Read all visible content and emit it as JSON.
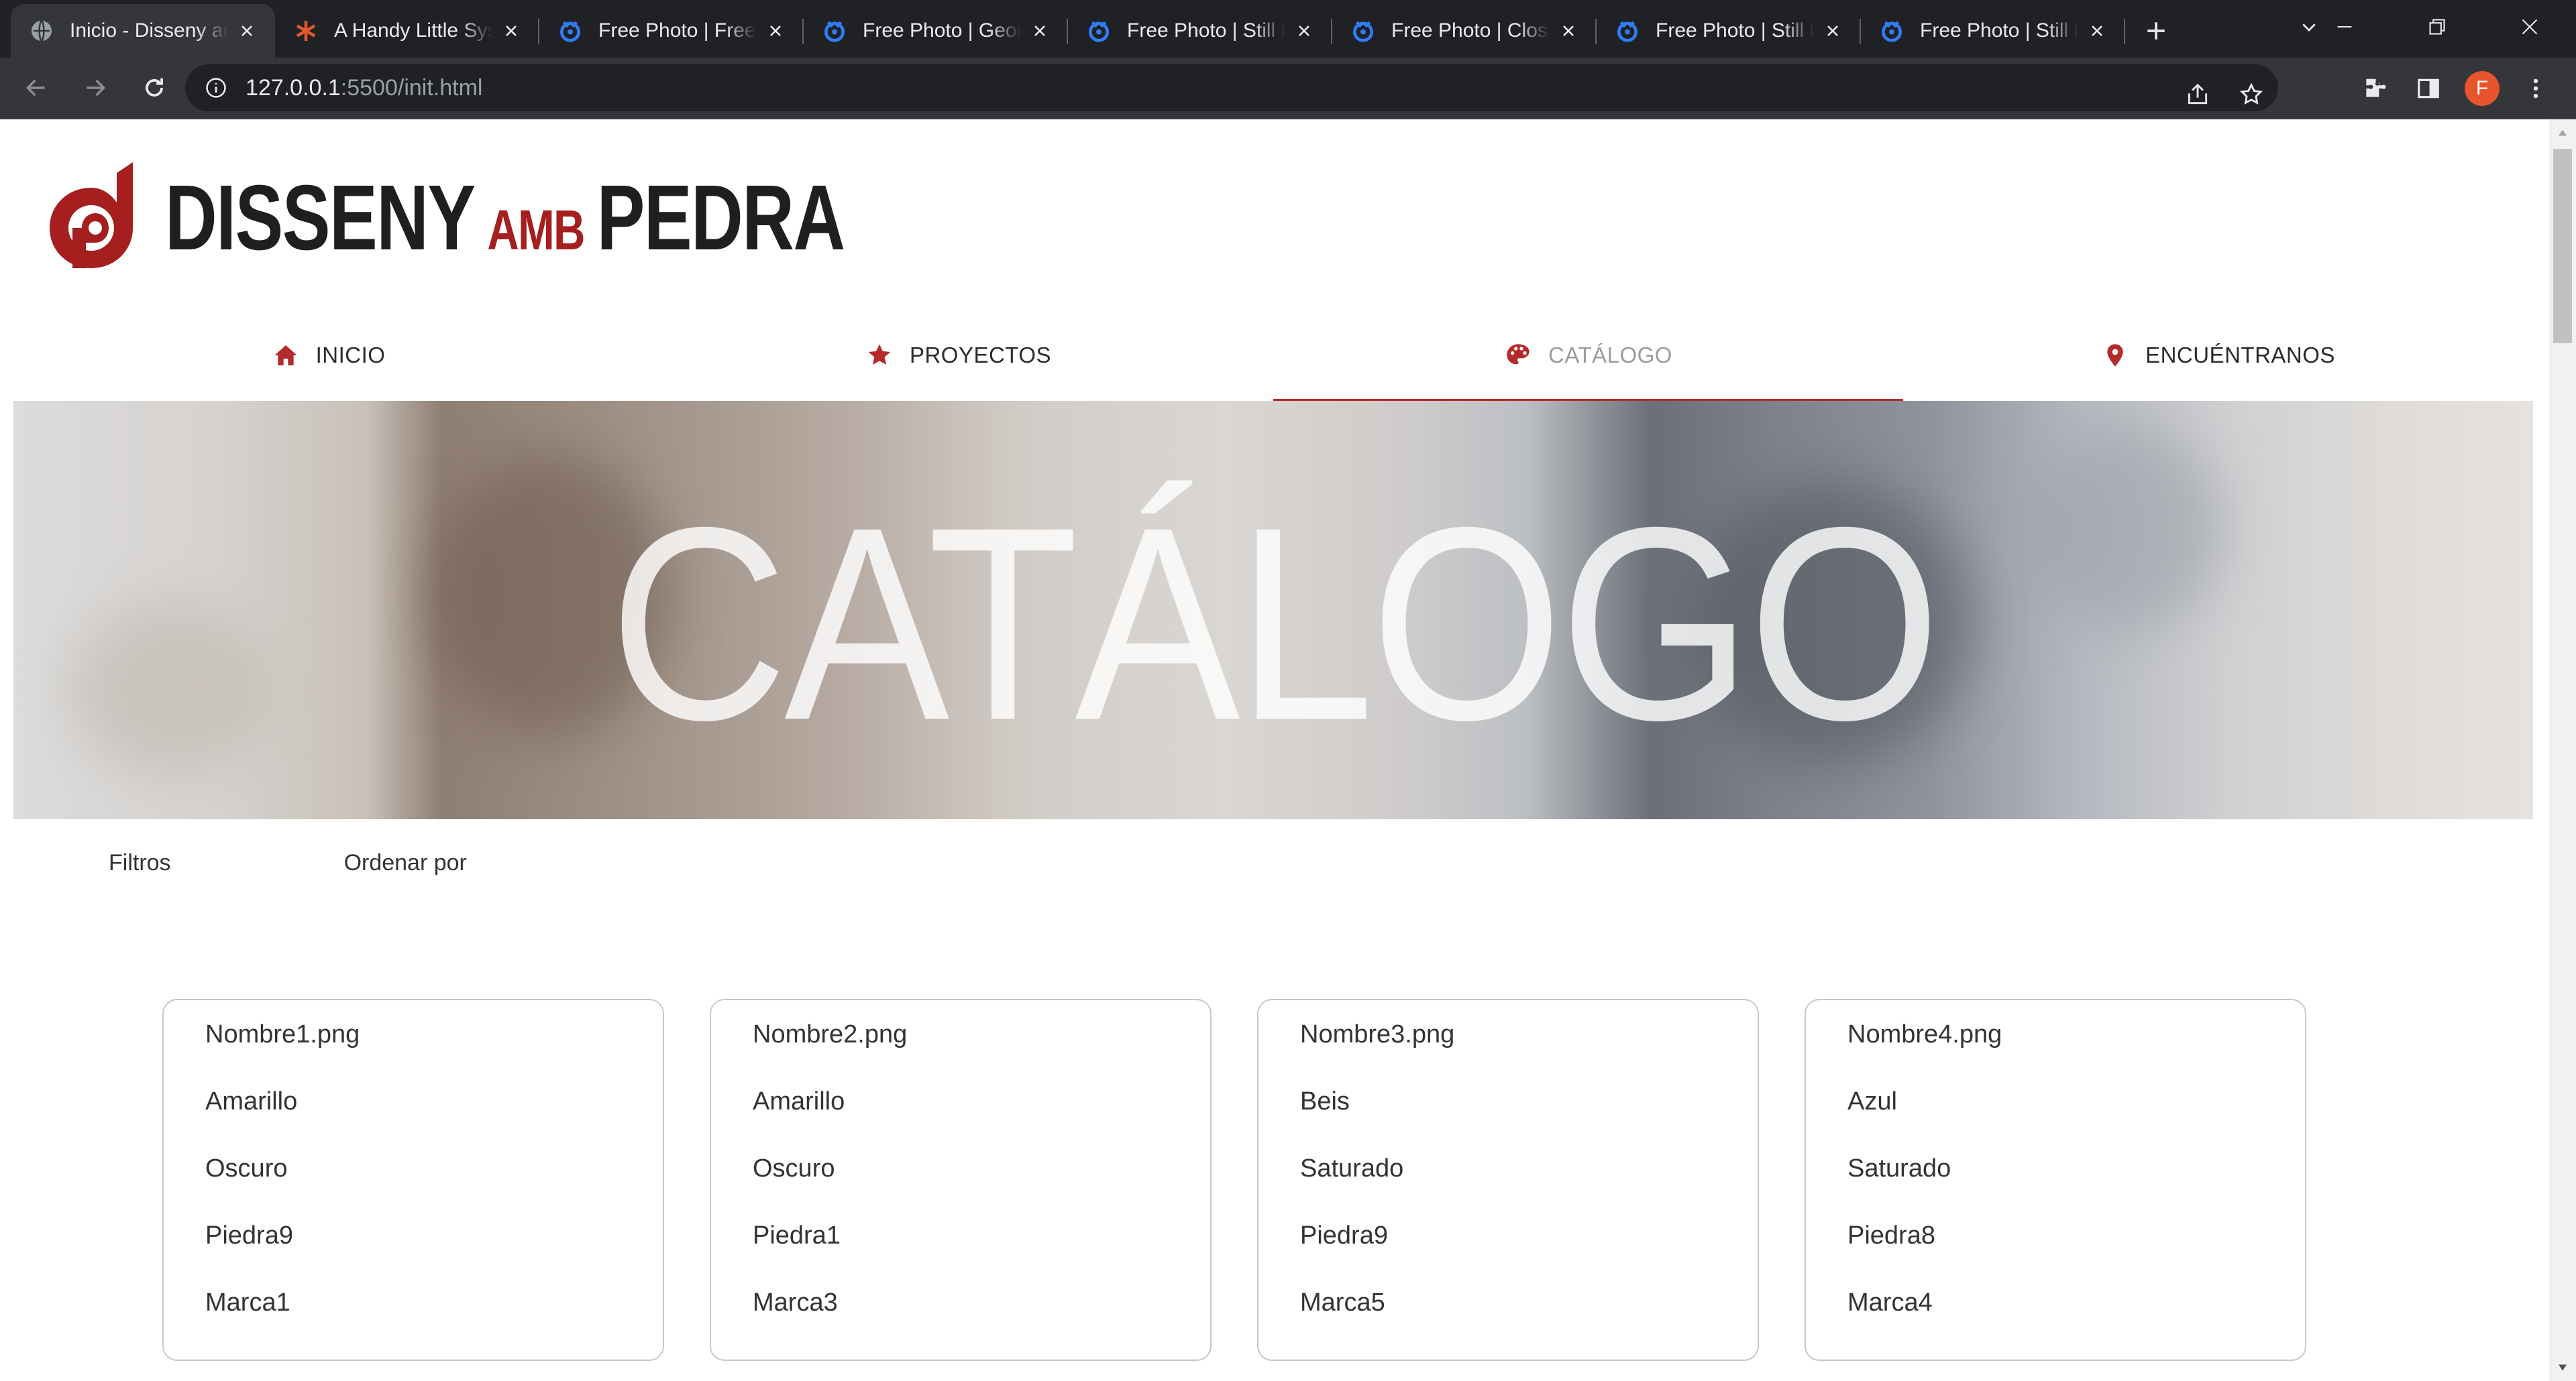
{
  "browser": {
    "tabs": [
      {
        "title": "Inicio - Disseny amb Pedra",
        "favicon": "globe-icon",
        "active": true
      },
      {
        "title": "A Handy Little System",
        "favicon": "asterisk-icon",
        "active": false
      },
      {
        "title": "Free Photo | Free",
        "favicon": "freepik-icon",
        "active": false
      },
      {
        "title": "Free Photo | Geometric",
        "favicon": "freepik-icon",
        "active": false
      },
      {
        "title": "Free Photo | Still life",
        "favicon": "freepik-icon",
        "active": false
      },
      {
        "title": "Free Photo | Close-up",
        "favicon": "freepik-icon",
        "active": false
      },
      {
        "title": "Free Photo | Still life",
        "favicon": "freepik-icon",
        "active": false
      },
      {
        "title": "Free Photo | Still life",
        "favicon": "freepik-icon",
        "active": false
      }
    ],
    "url_host": "127.0.0.1",
    "url_path": ":5500/init.html",
    "avatar_letter": "F"
  },
  "site": {
    "brand": {
      "part1": "DISSENY",
      "part2": "AMB",
      "part3": "PEDRA"
    },
    "nav": [
      {
        "label": "INICIO",
        "icon": "home-icon",
        "active": false
      },
      {
        "label": "PROYECTOS",
        "icon": "star-icon",
        "active": false
      },
      {
        "label": "CATÁLOGO",
        "icon": "palette-icon",
        "active": true
      },
      {
        "label": "ENCUÉNTRANOS",
        "icon": "location-pin-icon",
        "active": false
      }
    ],
    "hero_title": "CATÁLOGO",
    "filters_label": "Filtros",
    "sort_label": "Ordenar por",
    "cards": [
      {
        "name": "Nombre1.png",
        "color": "Amarillo",
        "tone": "Oscuro",
        "stone": "Piedra9",
        "brand": "Marca1"
      },
      {
        "name": "Nombre2.png",
        "color": "Amarillo",
        "tone": "Oscuro",
        "stone": "Piedra1",
        "brand": "Marca3"
      },
      {
        "name": "Nombre3.png",
        "color": "Beis",
        "tone": "Saturado",
        "stone": "Piedra9",
        "brand": "Marca5"
      },
      {
        "name": "Nombre4.png",
        "color": "Azul",
        "tone": "Saturado",
        "stone": "Piedra8",
        "brand": "Marca4"
      }
    ]
  },
  "colors": {
    "accent": "#b52a2a",
    "chrome_dark": "#202124",
    "chrome_toolbar": "#35363a"
  }
}
